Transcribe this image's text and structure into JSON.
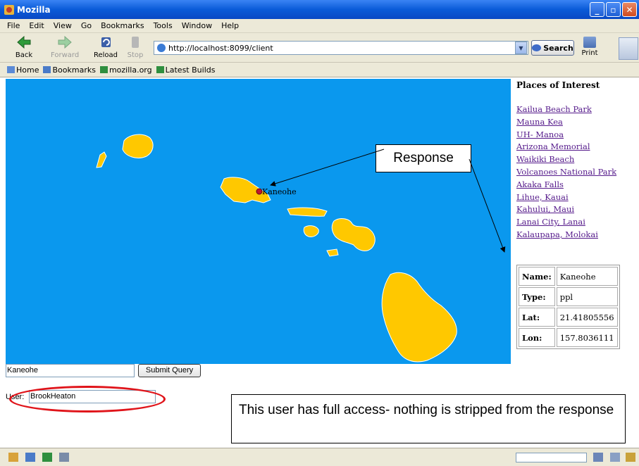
{
  "window": {
    "title": "Mozilla"
  },
  "menu": {
    "items": [
      "File",
      "Edit",
      "View",
      "Go",
      "Bookmarks",
      "Tools",
      "Window",
      "Help"
    ]
  },
  "toolbar": {
    "back": "Back",
    "forward": "Forward",
    "reload": "Reload",
    "stop": "Stop",
    "url": "http://localhost:8099/client",
    "search": "Search",
    "print": "Print"
  },
  "bookmarks": {
    "items": [
      "Home",
      "Bookmarks",
      "mozilla.org",
      "Latest Builds"
    ]
  },
  "map": {
    "marker_label": "Kaneohe",
    "colors": {
      "ocean": "#0a98ee",
      "land": "#ffc800",
      "marker": "#c0172e"
    }
  },
  "poi": {
    "title": "Places of Interest",
    "links": [
      "Kailua Beach Park",
      "Mauna Kea",
      "UH- Manoa",
      "Arizona Memorial",
      "Waikiki Beach",
      "Volcanoes National Park",
      "Akaka Falls",
      "Lihue, Kauai",
      "Kahului, Maui",
      "Lanai City, Lanai",
      "Kalaupapa, Molokai"
    ]
  },
  "details": {
    "rows": [
      {
        "key": "Name:",
        "value": "Kaneohe"
      },
      {
        "key": "Type:",
        "value": "ppl"
      },
      {
        "key": "Lat:",
        "value": "21.41805556"
      },
      {
        "key": "Lon:",
        "value": "157.8036111"
      }
    ]
  },
  "form": {
    "query_value": "Kaneohe",
    "submit_label": "Submit Query",
    "user_label": "User:",
    "user_value": "BrookHeaton"
  },
  "annotations": {
    "response_label": "Response",
    "note": "This user has full access- nothing is stripped from the response",
    "highlight_color": "#e0141a"
  }
}
